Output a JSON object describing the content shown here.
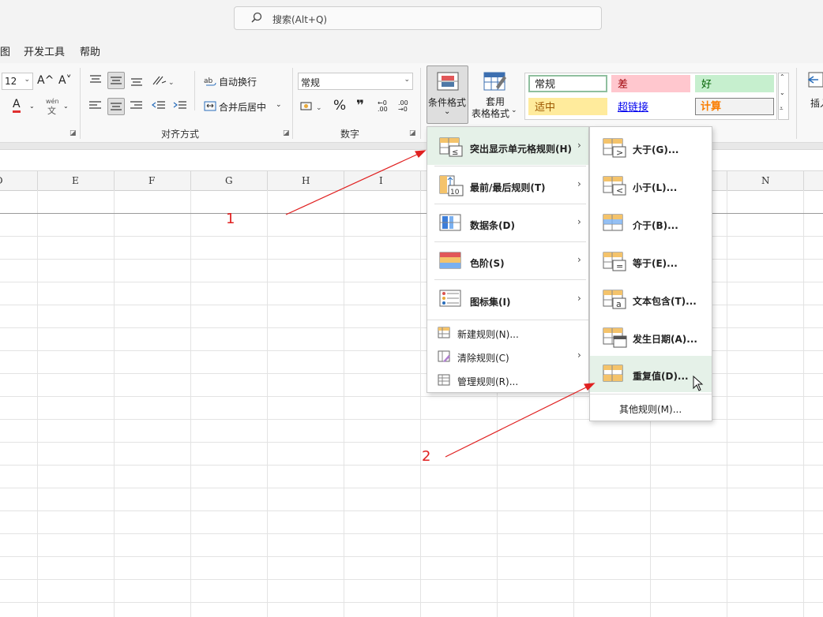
{
  "search": {
    "placeholder": "搜索(Alt+Q)",
    "icon": "search-icon"
  },
  "menubar": {
    "items": [
      "图",
      "开发工具",
      "帮助"
    ]
  },
  "ribbon": {
    "font": {
      "size": "12",
      "grow_label": "A^",
      "shrink_label": "A˅",
      "color_label": "A",
      "wen_label": "wén",
      "wen_char": "文"
    },
    "alignment": {
      "wrap_label": "自动换行",
      "merge_label": "合并后居中",
      "group_label": "对齐方式"
    },
    "number": {
      "format_value": "常规",
      "percent": "%",
      "comma": "❞",
      "dec_inc": "←0 .00",
      "dec_dec": ".00 →0",
      "group_label": "数字"
    },
    "styles": {
      "conditional_label": "条件格式",
      "table_label_line1": "套用",
      "table_label_line2": "表格格式",
      "cells": [
        {
          "label": "常规",
          "bg": "#ffffff",
          "border": "#8fbf9f",
          "color": "#222222"
        },
        {
          "label": "差",
          "bg": "#ffc7ce",
          "border": "#ffc7ce",
          "color": "#9c0006"
        },
        {
          "label": "好",
          "bg": "#c6efce",
          "border": "#c6efce",
          "color": "#006100"
        },
        {
          "label": "适中",
          "bg": "#ffeb9c",
          "border": "#ffeb9c",
          "color": "#9c5700"
        },
        {
          "label": "超链接",
          "bg": "#ffffff",
          "border": "#ffffff",
          "color": "#0000ee"
        },
        {
          "label": "计算",
          "bg": "#f2f2f2",
          "border": "#7f7f7f",
          "color": "#fa7d00"
        }
      ],
      "insert_label": "插入"
    }
  },
  "columns": [
    "D",
    "E",
    "F",
    "G",
    "H",
    "I",
    "N"
  ],
  "menu1": {
    "items": [
      {
        "label": "突出显示单元格规则(H)",
        "icon": "highlight-cells-rules-icon"
      },
      {
        "label": "最前/最后规则(T)",
        "icon": "top-bottom-rules-icon"
      },
      {
        "label": "数据条(D)",
        "icon": "data-bars-icon"
      },
      {
        "label": "色阶(S)",
        "icon": "color-scales-icon"
      },
      {
        "label": "图标集(I)",
        "icon": "icon-sets-icon"
      }
    ],
    "bottom": [
      {
        "label": "新建规则(N)...",
        "icon": "new-rule-icon"
      },
      {
        "label": "清除规则(C)",
        "icon": "clear-rules-icon"
      },
      {
        "label": "管理规则(R)...",
        "icon": "manage-rules-icon"
      }
    ]
  },
  "menu2": {
    "items": [
      {
        "label": "大于(G)...",
        "icon": "greater-than-icon",
        "glyph": ">"
      },
      {
        "label": "小于(L)...",
        "icon": "less-than-icon",
        "glyph": "<"
      },
      {
        "label": "介于(B)...",
        "icon": "between-icon",
        "glyph": ""
      },
      {
        "label": "等于(E)...",
        "icon": "equal-to-icon",
        "glyph": "="
      },
      {
        "label": "文本包含(T)...",
        "icon": "text-contains-icon",
        "glyph": "a"
      },
      {
        "label": "发生日期(A)...",
        "icon": "date-occurring-icon",
        "glyph": ""
      },
      {
        "label": "重复值(D)...",
        "icon": "duplicate-values-icon",
        "glyph": ""
      }
    ],
    "more_label": "其他规则(M)..."
  },
  "annotations": [
    "1",
    "2"
  ],
  "colors": {
    "annotation": "#e02020",
    "highlight": "#e5f1e8"
  }
}
